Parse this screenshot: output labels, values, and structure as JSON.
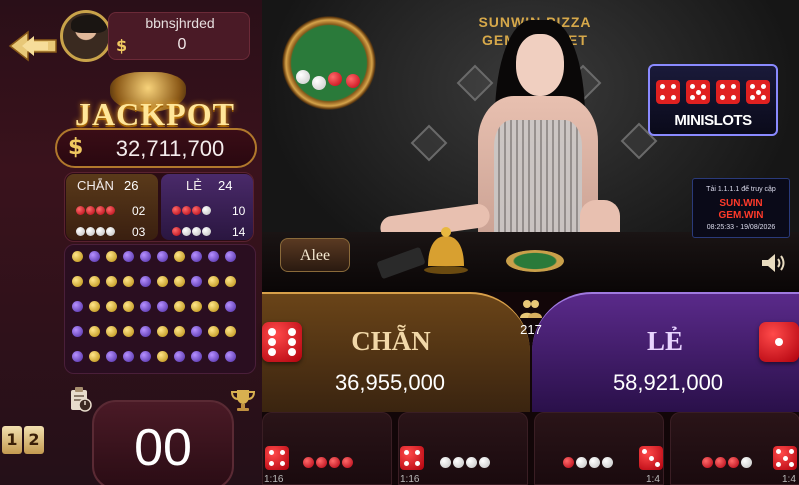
{
  "user": {
    "name": "bbnsjhrded",
    "currency_symbol": "$",
    "balance": "0"
  },
  "jackpot": {
    "title": "JACKPOT",
    "currency_symbol": "$",
    "value": "32,711,700"
  },
  "stats": {
    "chan": {
      "label": "CHẴN",
      "count": "26",
      "four_red": "02",
      "four_white": "03"
    },
    "le": {
      "label": "LẺ",
      "count": "24",
      "three_red": "10",
      "one_red": "14"
    }
  },
  "history_rows": [
    [
      "gold",
      "purple",
      "gold",
      "purple",
      "purple",
      "purple",
      "gold",
      "purple",
      "purple",
      "purple"
    ],
    [
      "gold",
      "gold",
      "gold",
      "gold",
      "purple",
      "gold",
      "gold",
      "purple",
      "gold",
      "gold"
    ],
    [
      "purple",
      "gold",
      "gold",
      "gold",
      "purple",
      "purple",
      "gold",
      "gold",
      "gold",
      "purple"
    ],
    [
      "purple",
      "gold",
      "gold",
      "gold",
      "purple",
      "gold",
      "gold",
      "purple",
      "gold",
      "gold"
    ],
    [
      "purple",
      "gold",
      "purple",
      "purple",
      "purple",
      "gold",
      "purple",
      "purple",
      "purple",
      "purple"
    ]
  ],
  "timer": {
    "value": "00"
  },
  "mode_switch": {
    "left": "1",
    "right": "2"
  },
  "stream": {
    "brand_line1": "SUNWIN PIZZA",
    "brand_line2": "GEM.WIN.BET",
    "dealer_name": "Alee",
    "minislots_label": "MINISLOTS",
    "sign_line1": "Tải 1.1.1.1 để truy cập",
    "sign_line2": "SUN.WIN",
    "sign_line3": "GEM.WIN",
    "sign_line4": "08:25:33 - 19/08/2026"
  },
  "bets": {
    "chan": {
      "label": "CHẴN",
      "amount": "36,955,000"
    },
    "le": {
      "label": "LẺ",
      "amount": "58,921,000"
    },
    "players": "217"
  },
  "side_bets": [
    {
      "ratio": "1:16"
    },
    {
      "ratio": "1:16"
    },
    {
      "ratio": "1:4"
    },
    {
      "ratio": "1:4"
    }
  ],
  "colors": {
    "gold": "#d8a04a",
    "purple": "#7a4ad0",
    "red": "#e02020"
  }
}
